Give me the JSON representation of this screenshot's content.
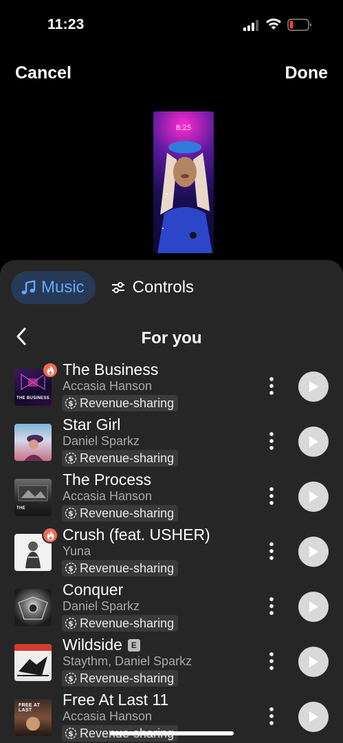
{
  "status_bar": {
    "time": "11:23"
  },
  "nav": {
    "cancel": "Cancel",
    "done": "Done"
  },
  "preview": {
    "time": "8:25"
  },
  "tabs": [
    {
      "label": "Music",
      "icon": "music-note-icon",
      "active": true
    },
    {
      "label": "Controls",
      "icon": "sliders-icon",
      "active": false
    }
  ],
  "section": {
    "title": "For you"
  },
  "revenue_label": "Revenue-sharing",
  "tracks": [
    {
      "title": "The Business",
      "artist": "Accasia Hanson",
      "hot": true,
      "explicit": false,
      "cover_text": "THE BUSINESS"
    },
    {
      "title": "Star Girl",
      "artist": "Daniel Sparkz",
      "hot": false,
      "explicit": false,
      "cover_text": ""
    },
    {
      "title": "The Process",
      "artist": "Accasia Hanson",
      "hot": false,
      "explicit": false,
      "cover_text": "THE"
    },
    {
      "title": "Crush (feat. USHER)",
      "artist": "Yuna",
      "hot": true,
      "explicit": false,
      "cover_text": ""
    },
    {
      "title": "Conquer",
      "artist": "Daniel Sparkz",
      "hot": false,
      "explicit": false,
      "cover_text": ""
    },
    {
      "title": "Wildside",
      "artist": "Staythm, Daniel Sparkz",
      "hot": false,
      "explicit": true,
      "explicit_label": "E",
      "cover_text": ""
    },
    {
      "title": "Free At Last 11",
      "artist": "Accasia Hanson",
      "hot": false,
      "explicit": false,
      "cover_text": "FREE AT LAST"
    }
  ],
  "colors": {
    "accent": "#64a9ff",
    "sheet": "#262626",
    "hot_badge": "#ef6a57",
    "battery_low": "#ff3b30"
  }
}
